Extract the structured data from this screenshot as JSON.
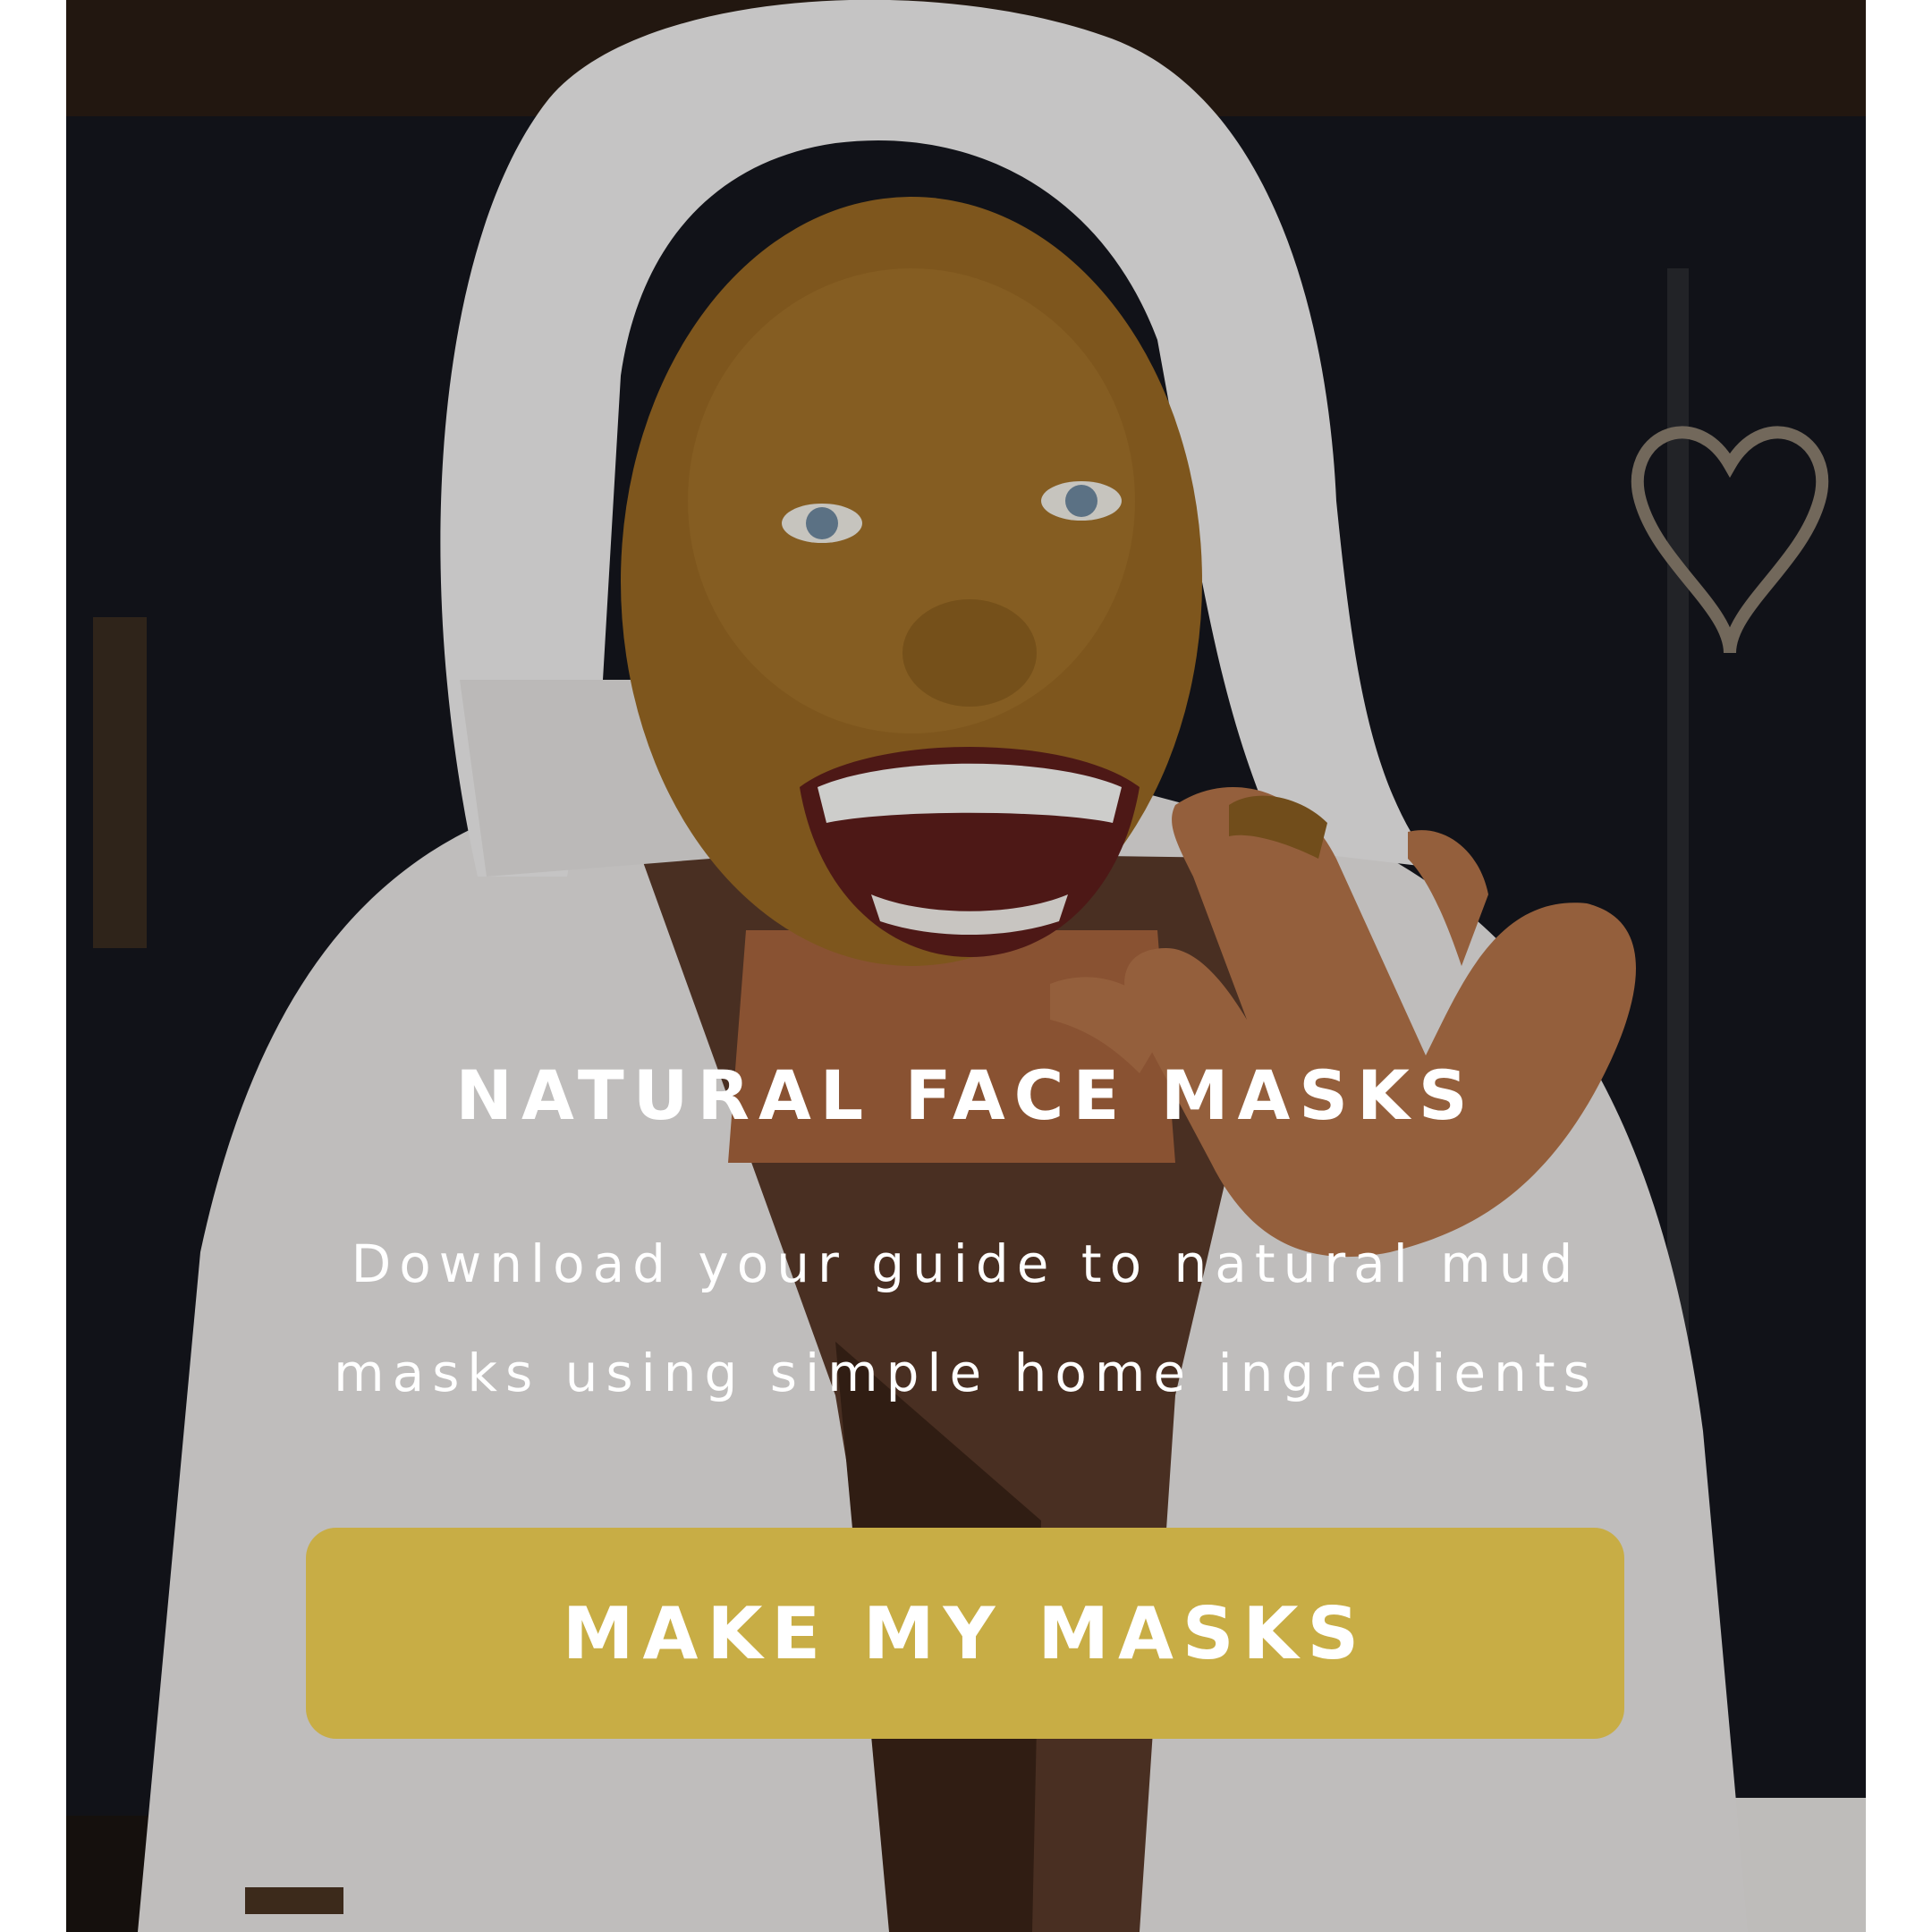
{
  "hero": {
    "image_alt": "Woman wearing a white towel on her head and a white waffle bathrobe, laughing with a natural mud face mask applied"
  },
  "content": {
    "title": "NATURAL FACE MASKS",
    "subtitle_line1": "Download your guide to natural mud",
    "subtitle_line2": "masks using simple home ingredients"
  },
  "cta": {
    "label": "MAKE MY MASKS",
    "color": "#c8ad45"
  }
}
